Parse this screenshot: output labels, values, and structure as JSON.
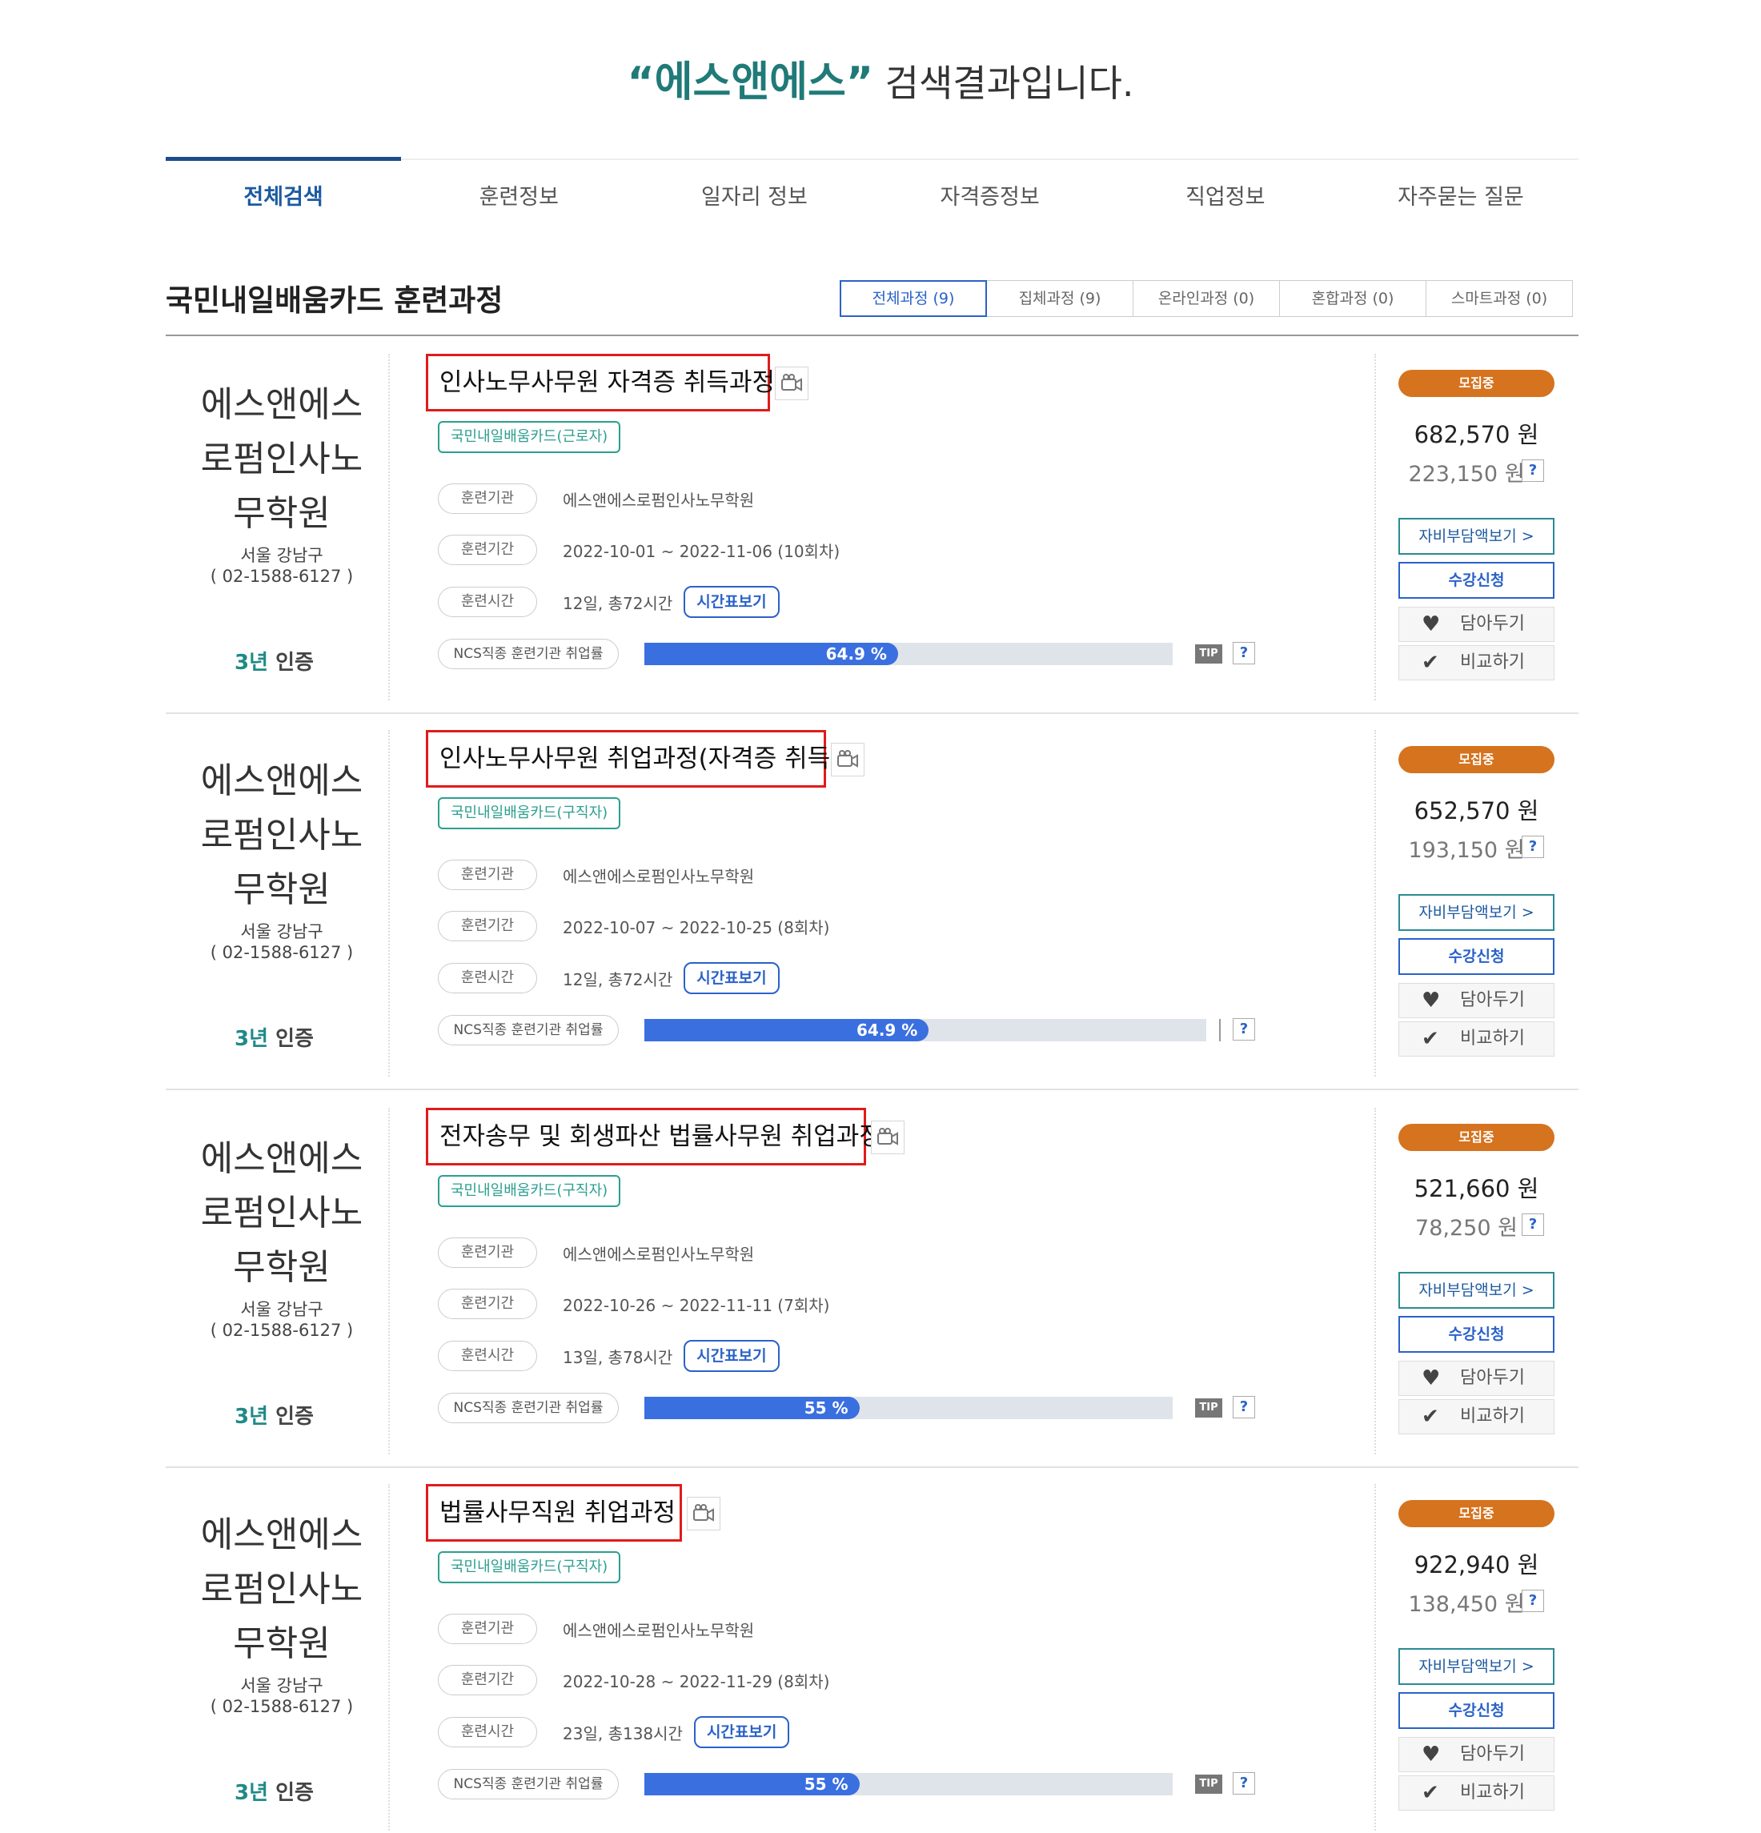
{
  "header": {
    "keyword": "“에스앤에스”",
    "suffix": "검색결과입니다."
  },
  "tabs": [
    {
      "label": "전체검색",
      "active": true
    },
    {
      "label": "훈련정보"
    },
    {
      "label": "일자리 정보"
    },
    {
      "label": "자격증정보"
    },
    {
      "label": "직업정보"
    },
    {
      "label": "자주묻는 질문"
    }
  ],
  "section": {
    "title": "국민내일배움카드 훈련과정",
    "filters": [
      {
        "label": "전체과정 (9)",
        "active": true
      },
      {
        "label": "집체과정 (9)"
      },
      {
        "label": "온라인과정 (0)"
      },
      {
        "label": "혼합과정 (0)"
      },
      {
        "label": "스마트과정 (0)"
      }
    ]
  },
  "labels": {
    "institution": "훈련기관",
    "period": "훈련기간",
    "hours": "훈련시간",
    "ncs": "NCS직종 훈련기관 취업률",
    "timetable": "시간표보기",
    "tip": "TIP",
    "help": "?",
    "recruiting": "모집중",
    "self_pay": "자비부담액보기 >",
    "apply": "수강신청",
    "save": "담아두기",
    "compare": "비교하기",
    "won": "원",
    "cert_num": "3년",
    "cert_text": "인증"
  },
  "icons": {
    "camera": "video-camera-icon",
    "heart": "heart-icon",
    "check": "check-icon"
  },
  "colors": {
    "accent": "#2a62c9",
    "keyword": "#1f7a78",
    "badge": "#d5731f",
    "highlight_box": "#e01b1b",
    "progress": "#3a6fe0"
  },
  "courses": [
    {
      "inst_name": "에스앤에스로펌인사노무학원",
      "inst_line1": "에스앤에스",
      "inst_line2": "로펌인사노",
      "inst_line3": "무학원",
      "location": "서울 강남구",
      "phone": "( 02-1588-6127 )",
      "title": "인사노무사무원 자격증 취득과정",
      "card_type": "국민내일배움카드(근로자)",
      "institution": "에스앤에스로펌인사노무학원",
      "period": "2022-10-01 ~ 2022-11-06 (10회차)",
      "hours": "12일, 총72시간",
      "rate": 64.9,
      "rate_label": "64.9 %",
      "show_tip": true,
      "price": "682,570",
      "self_price": "223,150"
    },
    {
      "inst_name": "에스앤에스로펌인사노무학원",
      "inst_line1": "에스앤에스",
      "inst_line2": "로펌인사노",
      "inst_line3": "무학원",
      "location": "서울 강남구",
      "phone": "( 02-1588-6127 )",
      "title": "인사노무사무원 취업과정(자격증 취득)",
      "card_type": "국민내일배움카드(구직자)",
      "institution": "에스앤에스로펌인사노무학원",
      "period": "2022-10-07 ~ 2022-10-25 (8회차)",
      "hours": "12일, 총72시간",
      "rate": 64.9,
      "rate_label": "64.9 %",
      "show_tip": false,
      "price": "652,570",
      "self_price": "193,150"
    },
    {
      "inst_name": "에스앤에스로펌인사노무학원",
      "inst_line1": "에스앤에스",
      "inst_line2": "로펌인사노",
      "inst_line3": "무학원",
      "location": "서울 강남구",
      "phone": "( 02-1588-6127 )",
      "title": "전자송무 및 회생파산 법률사무원 취업과정",
      "card_type": "국민내일배움카드(구직자)",
      "institution": "에스앤에스로펌인사노무학원",
      "period": "2022-10-26 ~ 2022-11-11 (7회차)",
      "hours": "13일, 총78시간",
      "rate": 55,
      "rate_label": "55 %",
      "show_tip": true,
      "price": "521,660",
      "self_price": "78,250"
    },
    {
      "inst_name": "에스앤에스로펌인사노무학원",
      "inst_line1": "에스앤에스",
      "inst_line2": "로펌인사노",
      "inst_line3": "무학원",
      "location": "서울 강남구",
      "phone": "( 02-1588-6127 )",
      "title": "법률사무직원 취업과정",
      "card_type": "국민내일배움카드(구직자)",
      "institution": "에스앤에스로펌인사노무학원",
      "period": "2022-10-28 ~ 2022-11-29 (8회차)",
      "hours": "23일, 총138시간",
      "rate": 55,
      "rate_label": "55 %",
      "show_tip": true,
      "price": "922,940",
      "self_price": "138,450"
    }
  ]
}
